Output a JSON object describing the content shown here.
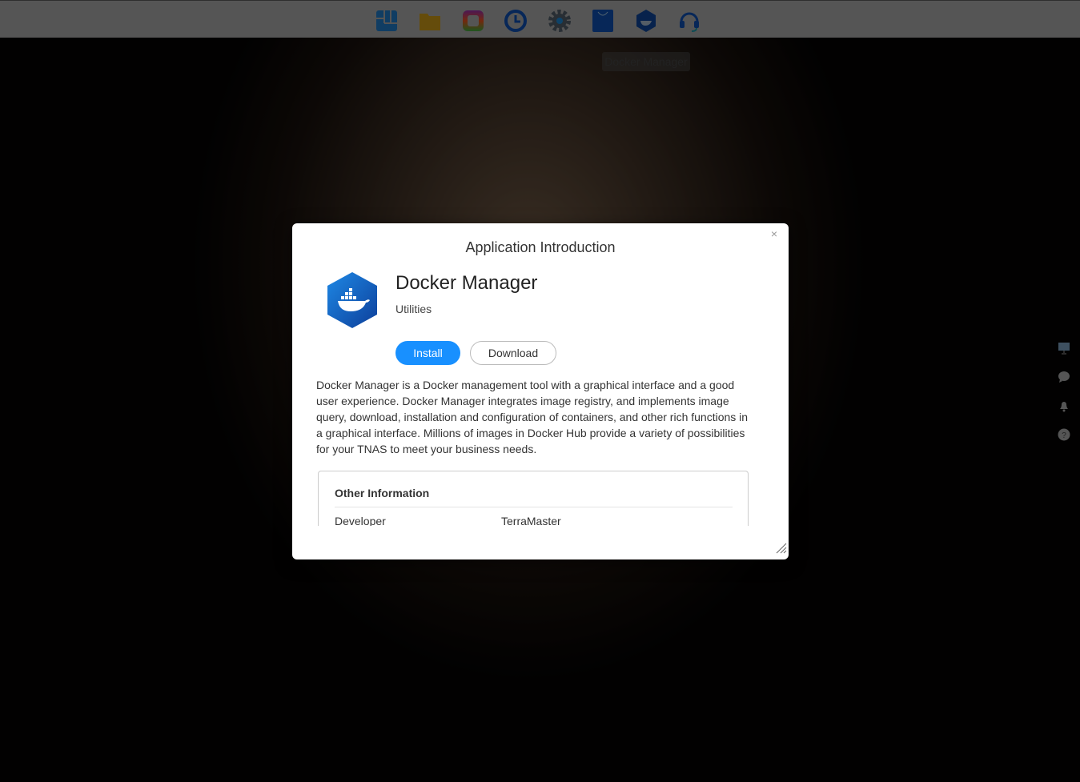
{
  "taskbar": {
    "apps": [
      "control-panel",
      "file-manager",
      "tos-apps",
      "backup",
      "settings",
      "app-center",
      "docker-manager",
      "help-center"
    ]
  },
  "tooltip": "Docker Manager",
  "dialog": {
    "title": "Application Introduction",
    "close": "×",
    "app_name": "Docker Manager",
    "category": "Utilities",
    "install_label": "Install",
    "download_label": "Download",
    "description": "Docker Manager is a Docker management tool with a graphical interface and a good user experience. Docker Manager integrates image registry, and implements image query, download, installation and configuration of containers, and other rich functions in a graphical interface. Millions of images in Docker Hub provide a variety of possibilities for your TNAS to meet your business needs.",
    "other_info": {
      "heading": "Other Information",
      "rows": [
        {
          "label": "Developer",
          "value": "TerraMaster"
        }
      ]
    }
  },
  "colors": {
    "accent": "#1890ff",
    "docker": "#1565c0"
  }
}
